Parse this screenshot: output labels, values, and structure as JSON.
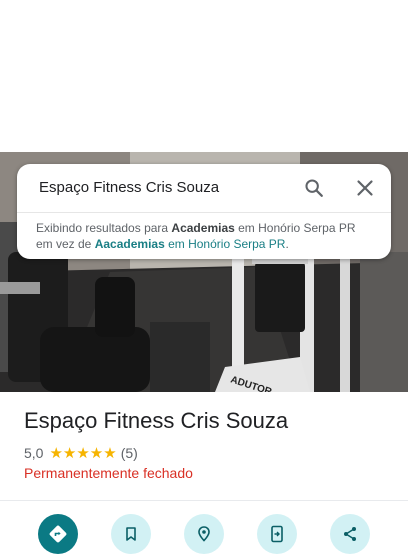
{
  "search": {
    "query": "Espaço Fitness Cris Souza",
    "search_icon": "search-icon",
    "close_icon": "close-icon"
  },
  "notice": {
    "line1_prefix": "Exibindo resultados para ",
    "line1_term": "Academias",
    "line1_suffix": " em Honório Serpa PR",
    "line2_prefix": "em vez de ",
    "line2_term": "Aacademias",
    "line2_suffix": " em Honório Serpa PR",
    "line2_end": "."
  },
  "photo": {
    "sign_text": "ADUTOR"
  },
  "place": {
    "title": "Espaço Fitness Cris Souza",
    "rating": "5,0",
    "stars": "★★★★★",
    "reviews": "(5)",
    "status": "Permanentemente fechado"
  },
  "actions": [
    {
      "icon": "directions-icon"
    },
    {
      "icon": "bookmark-icon"
    },
    {
      "icon": "nearby-icon"
    },
    {
      "icon": "send-to-phone-icon"
    },
    {
      "icon": "share-icon"
    }
  ],
  "colors": {
    "accent": "#0b7a84",
    "action_bg": "#d2f1f4",
    "closed": "#d93025",
    "star": "#f6b400",
    "suggestion": "#1a7f85"
  }
}
